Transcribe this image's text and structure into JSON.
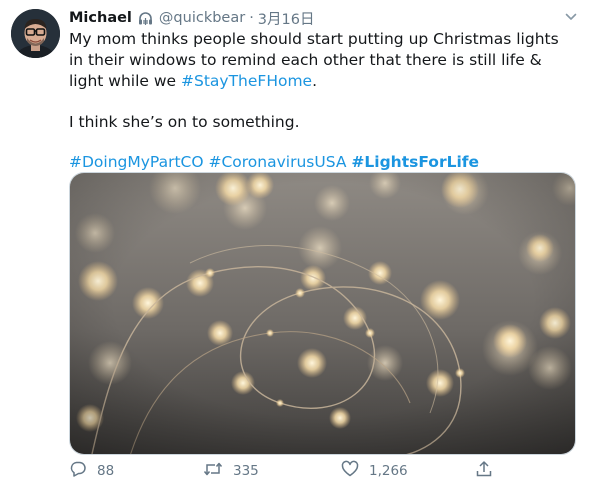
{
  "tweet": {
    "display_name": "Michael",
    "handle": "@quickbear",
    "separator": "·",
    "date": "3月16日",
    "text_line1_a": "My mom thinks people should start putting up Christmas lights in their windows to remind each other that there is still life & light while we ",
    "text_line1_tag": "#StayTheFHome",
    "text_line1_end": ".",
    "text_line2": "I think she’s on to something.",
    "hashtags": [
      "#DoingMyPartCO",
      "#CoronavirusUSA",
      "#LightsForLife"
    ]
  },
  "actions": {
    "reply_count": "88",
    "retweet_count": "335",
    "like_count": "1,266"
  },
  "icons": {
    "verified": "headphones-badge-icon",
    "caret": "chevron-down-icon",
    "reply": "speech-bubble-icon",
    "retweet": "retweet-arrows-icon",
    "like": "heart-icon",
    "share": "share-upload-icon"
  },
  "colors": {
    "link": "#1b95e0",
    "muted": "#657786",
    "text": "#14171a"
  }
}
